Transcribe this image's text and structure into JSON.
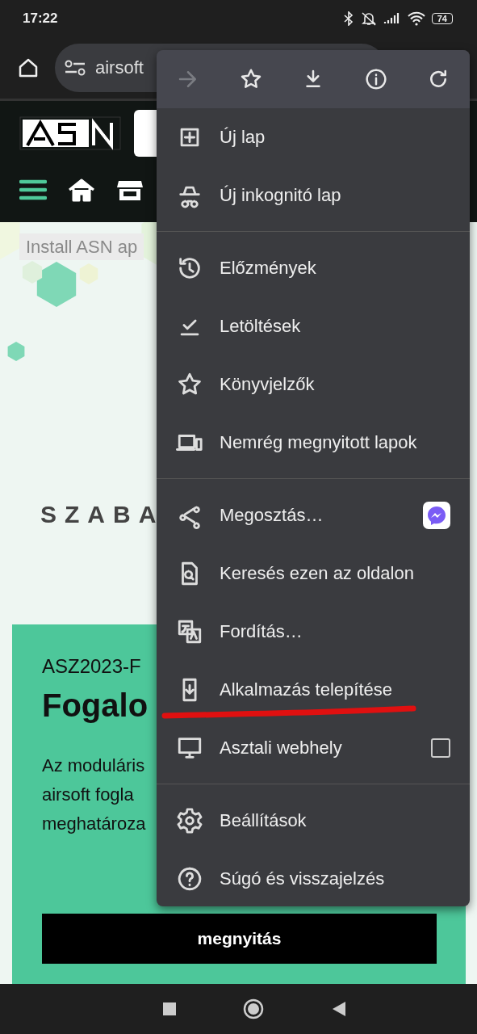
{
  "status_bar": {
    "time": "17:22",
    "battery": "74"
  },
  "browser": {
    "url": "airsoft"
  },
  "site": {
    "install_hint": "Install ASN ap",
    "subtitle": "SZABA",
    "card": {
      "code": "ASZ2023-F",
      "title": "Fogalo",
      "body": [
        "Az moduláris",
        "airsoft fogla",
        "meghatároza"
      ],
      "button": "megnyitás"
    }
  },
  "menu": {
    "toolbar": [
      {
        "disabled": true
      },
      {
        "disabled": false
      },
      {
        "disabled": false
      },
      {
        "disabled": false
      },
      {
        "disabled": false
      }
    ],
    "groups": [
      [
        {
          "label": "Új lap",
          "kind": "plain"
        },
        {
          "label": "Új inkognitó lap",
          "kind": "plain"
        }
      ],
      [
        {
          "label": "Előzmények",
          "kind": "plain"
        },
        {
          "label": "Letöltések",
          "kind": "plain"
        },
        {
          "label": "Könyvjelzők",
          "kind": "plain"
        },
        {
          "label": "Nemrég megnyitott lapok",
          "kind": "plain"
        }
      ],
      [
        {
          "label": "Megosztás…",
          "kind": "app"
        },
        {
          "label": "Keresés ezen az oldalon",
          "kind": "plain"
        },
        {
          "label": "Fordítás…",
          "kind": "plain"
        },
        {
          "label": "Alkalmazás telepítése",
          "kind": "plain"
        },
        {
          "label": "Asztali webhely",
          "kind": "checkbox",
          "checked": false
        }
      ],
      [
        {
          "label": "Beállítások",
          "kind": "plain"
        },
        {
          "label": "Súgó és visszajelzés",
          "kind": "plain"
        }
      ]
    ]
  }
}
